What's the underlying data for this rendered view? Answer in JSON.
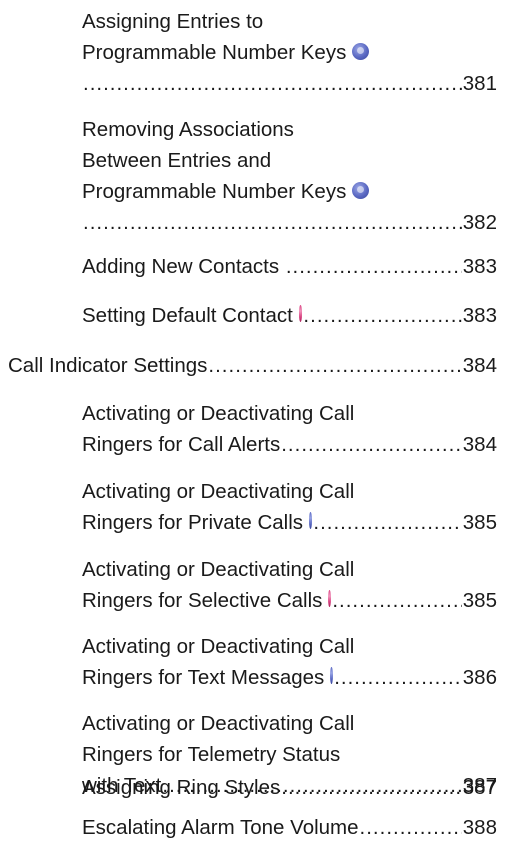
{
  "dot_leader": "................................................................................................................",
  "colors": {
    "text": "#1a1a1a",
    "icon_blue": "#5a68c2",
    "icon_pink": "#d8407f"
  },
  "entries": [
    {
      "lines": [
        "Assigning Entries to",
        "Programmable Number Keys"
      ],
      "page": "381",
      "icon": "blue-icon",
      "icon_inline": true
    },
    {
      "lines": [
        "Removing Associations",
        "Between Entries and",
        "Programmable Number Keys"
      ],
      "page": "382",
      "icon": "blue-icon",
      "icon_inline": true
    },
    {
      "lines": [
        "Adding New Contacts "
      ],
      "page": "383",
      "icon": null
    },
    {
      "lines": [
        "Setting Default Contact"
      ],
      "page": "383",
      "icon": "pink-icon"
    },
    {
      "lines": [
        "Call Indicator Settings"
      ],
      "page": "384",
      "icon": null
    },
    {
      "lines": [
        "Activating or Deactivating Call",
        "Ringers for Call Alerts"
      ],
      "page": "384",
      "icon": null
    },
    {
      "lines": [
        "Activating or Deactivating Call",
        "Ringers for Private Calls"
      ],
      "page": "385",
      "icon": "blue-icon"
    },
    {
      "lines": [
        "Activating or Deactivating Call",
        "Ringers for Selective Calls"
      ],
      "page": "385",
      "icon": "pink-icon"
    },
    {
      "lines": [
        "Activating or Deactivating Call",
        "Ringers for Text Messages"
      ],
      "page": "386",
      "icon": "blue-icon"
    },
    {
      "lines": [
        "Activating or Deactivating Call",
        "Ringers for Telemetry Status",
        "with Text"
      ],
      "page": "387",
      "icon": null
    },
    {
      "lines": [
        "Assigning Ring Styles"
      ],
      "page": "387",
      "icon": null
    },
    {
      "lines": [
        "Escalating Alarm Tone Volume"
      ],
      "page": "388",
      "icon": null
    }
  ]
}
